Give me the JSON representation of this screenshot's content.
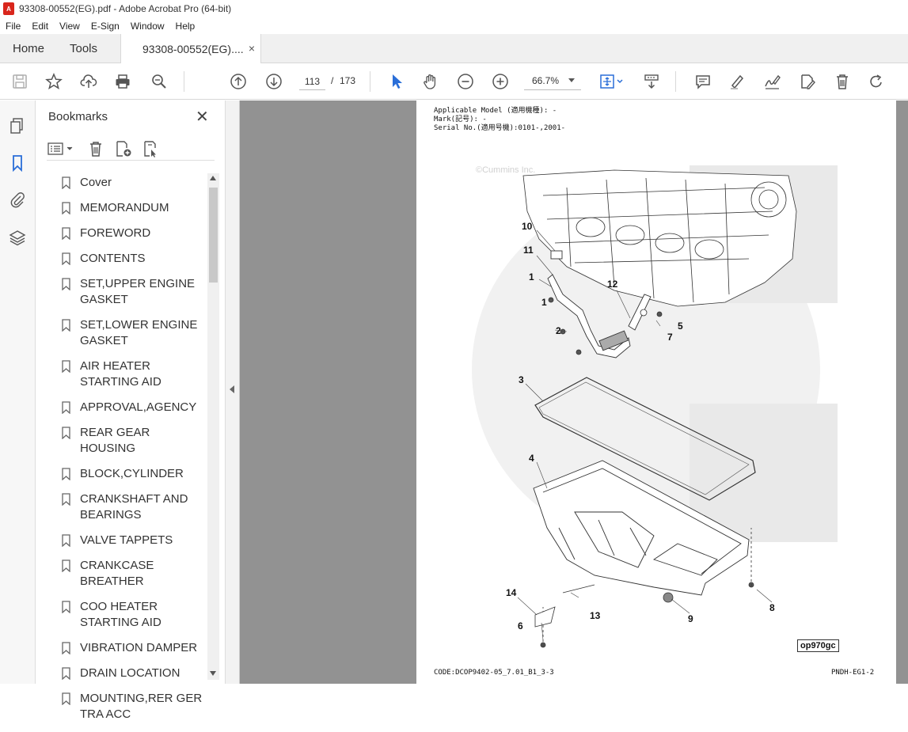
{
  "window": {
    "title": "93308-00552(EG).pdf - Adobe Acrobat Pro (64-bit)"
  },
  "menu": [
    "File",
    "Edit",
    "View",
    "E-Sign",
    "Window",
    "Help"
  ],
  "tabs": {
    "home": "Home",
    "tools": "Tools",
    "document": "93308-00552(EG)....",
    "close_glyph": "×"
  },
  "toolbar": {
    "current_page": "113",
    "page_sep": "/",
    "total_pages": "173",
    "zoom": "66.7%",
    "icons": [
      "save-icon",
      "star-icon",
      "upload-icon",
      "print-icon",
      "find-icon",
      "prev-page-icon",
      "next-page-icon",
      "select-cursor-icon",
      "hand-icon",
      "zoom-out-icon",
      "zoom-in-icon",
      "fit-page-icon",
      "scroll-mode-icon",
      "comment-icon",
      "highlight-icon",
      "sign-icon",
      "edit-icon",
      "delete-icon",
      "rotate-icon"
    ]
  },
  "bookmarks": {
    "title": "Bookmarks",
    "close_glyph": "✕",
    "items": [
      "Cover",
      "MEMORANDUM",
      "FOREWORD",
      "CONTENTS",
      "SET,UPPER ENGINE GASKET",
      "SET,LOWER ENGINE GASKET",
      "AIR HEATER STARTING AID",
      "APPROVAL,AGENCY",
      "REAR GEAR HOUSING",
      "BLOCK,CYLINDER",
      "CRANKSHAFT AND BEARINGS",
      "VALVE TAPPETS",
      "CRANKCASE BREATHER",
      "COO HEATER STARTING AID",
      "VIBRATION DAMPER",
      "DRAIN LOCATION",
      "MOUNTING,RER GER TRA ACC"
    ]
  },
  "page": {
    "header": "Applicable Model (適用機種): -\nMark(記号): -\nSerial No.(適用号機):0101-,2001-",
    "watermark": "©Cummins Inc.",
    "footer_code": "CODE:DCOP9402-05_7.01_B1_3-3",
    "footer_page": "PNDH-EG1-2",
    "figure_id": "op970gc",
    "callouts": [
      "10",
      "11",
      "1",
      "1",
      "12",
      "5",
      "2",
      "7",
      "3",
      "4",
      "14",
      "13",
      "9",
      "8",
      "6"
    ]
  }
}
